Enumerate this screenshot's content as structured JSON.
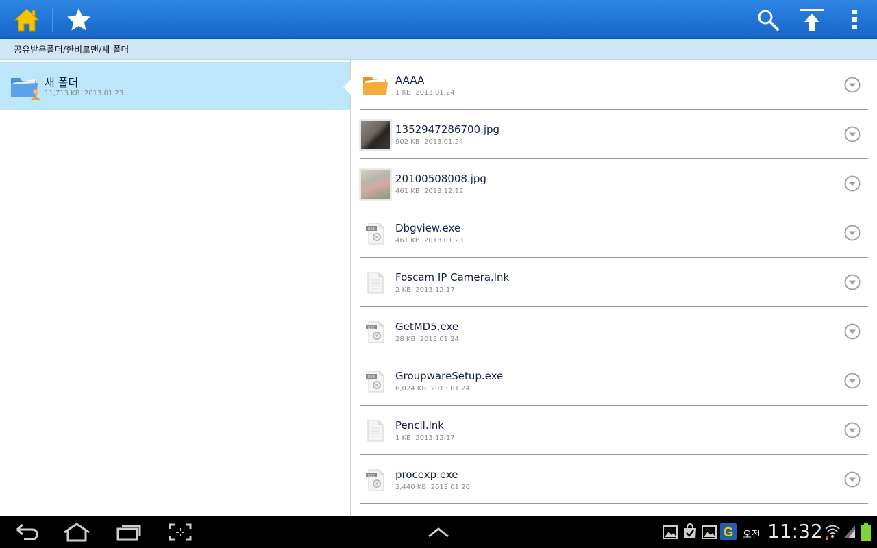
{
  "actionbar": {
    "home_icon": "home-icon",
    "favorite_icon": "star-icon",
    "search_icon": "search-icon",
    "upload_icon": "upload-icon",
    "overflow_icon": "overflow-menu-icon"
  },
  "breadcrumb": {
    "path": "공유받은폴더/한비로맨/새 폴더"
  },
  "left_pane": {
    "folder": {
      "name": "새 폴더",
      "size": "11,713 KB",
      "date": "2013.01.23"
    }
  },
  "files": [
    {
      "name": "AAAA",
      "size": "1 KB",
      "date": "2013.01.24",
      "type": "folder"
    },
    {
      "name": "1352947286700.jpg",
      "size": "902 KB",
      "date": "2013.01.24",
      "type": "image"
    },
    {
      "name": "20100508008.jpg",
      "size": "461 KB",
      "date": "2013.12.12",
      "type": "image"
    },
    {
      "name": "Dbgview.exe",
      "size": "461 KB",
      "date": "2013.01.23",
      "type": "exe"
    },
    {
      "name": "Foscam IP Camera.lnk",
      "size": "2 KB",
      "date": "2013.12.17",
      "type": "file"
    },
    {
      "name": "GetMD5.exe",
      "size": "28 KB",
      "date": "2013.01.24",
      "type": "exe"
    },
    {
      "name": "GroupwareSetup.exe",
      "size": "6,024 KB",
      "date": "2013.01.24",
      "type": "exe"
    },
    {
      "name": "Pencil.lnk",
      "size": "1 KB",
      "date": "2013.12.17",
      "type": "file"
    },
    {
      "name": "procexp.exe",
      "size": "3,440 KB",
      "date": "2013.01.26",
      "type": "exe"
    }
  ],
  "statusbar": {
    "ampm": "오전",
    "time": "11:32"
  },
  "colors": {
    "actionbar": "#1f74d6",
    "breadcrumb_bg": "#cfe6f7",
    "selected_bg": "#bde6fb",
    "battery": "#7fd43a",
    "home_icon": "#f5c400"
  }
}
